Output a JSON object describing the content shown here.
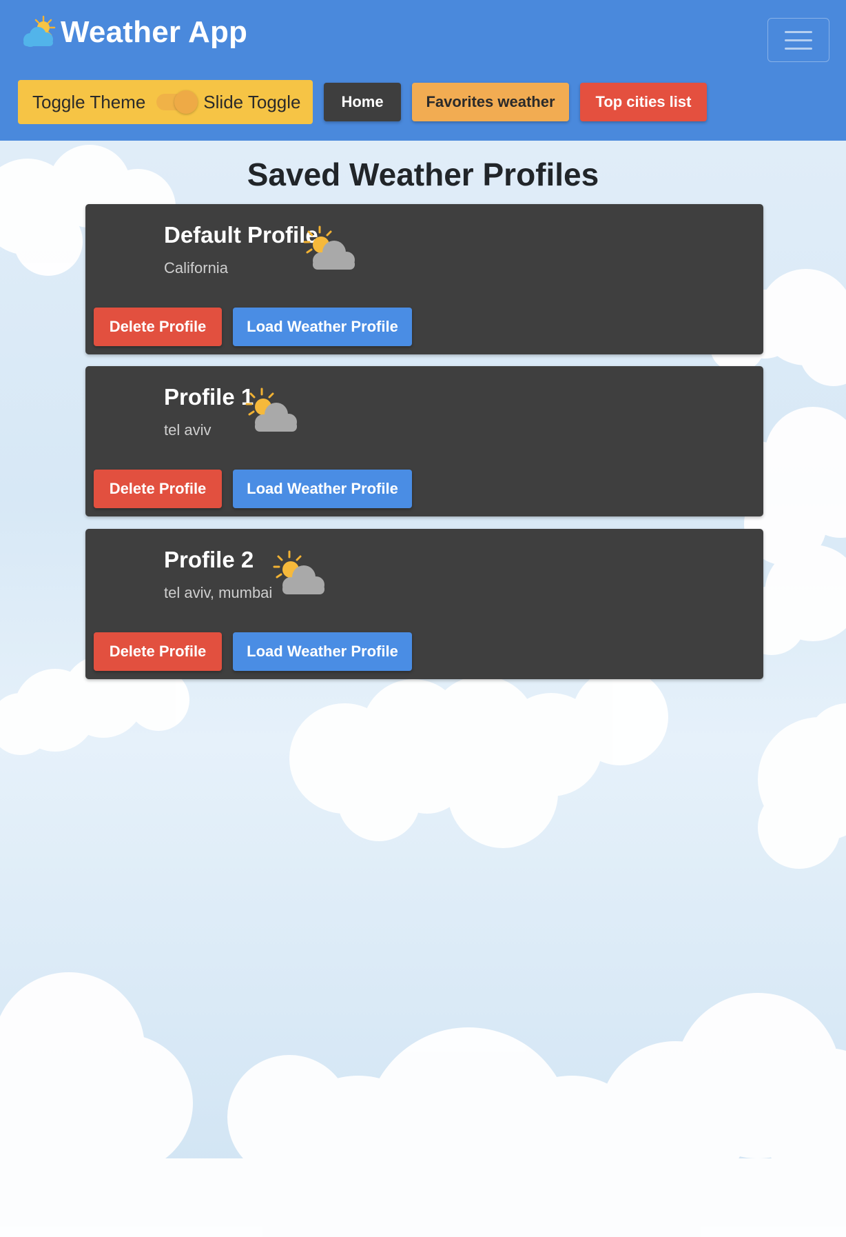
{
  "header": {
    "app_title": "Weather App",
    "app_icon": "sun-cloud-icon",
    "menu_icon": "hamburger-menu-icon",
    "theme_toggle_label": "Toggle Theme",
    "slide_toggle_label": "Slide Toggle",
    "nav": {
      "home_label": "Home",
      "favorites_label": "Favorites weather",
      "top_cities_label": "Top cities list"
    },
    "colors": {
      "header_bg": "#4a89dc",
      "theme_box": "#f6c445",
      "home": "#3e3e3e",
      "favorites": "#f2ac52",
      "top_cities": "#e4503f"
    }
  },
  "main": {
    "page_title": "Saved Weather Profiles",
    "profiles": [
      {
        "name": "Default Profile",
        "cities": "California",
        "icon": "partly-cloudy-icon",
        "delete_label": "Delete Profile",
        "load_label": "Load Weather Profile"
      },
      {
        "name": "Profile 1",
        "cities": "tel aviv",
        "icon": "partly-cloudy-icon",
        "delete_label": "Delete Profile",
        "load_label": "Load Weather Profile"
      },
      {
        "name": "Profile 2",
        "cities": "tel aviv, mumbai",
        "icon": "partly-cloudy-icon",
        "delete_label": "Delete Profile",
        "load_label": "Load Weather Profile"
      }
    ],
    "colors": {
      "card_bg": "#3f3f3f",
      "delete": "#e2503f",
      "load": "#4a8de4"
    }
  }
}
